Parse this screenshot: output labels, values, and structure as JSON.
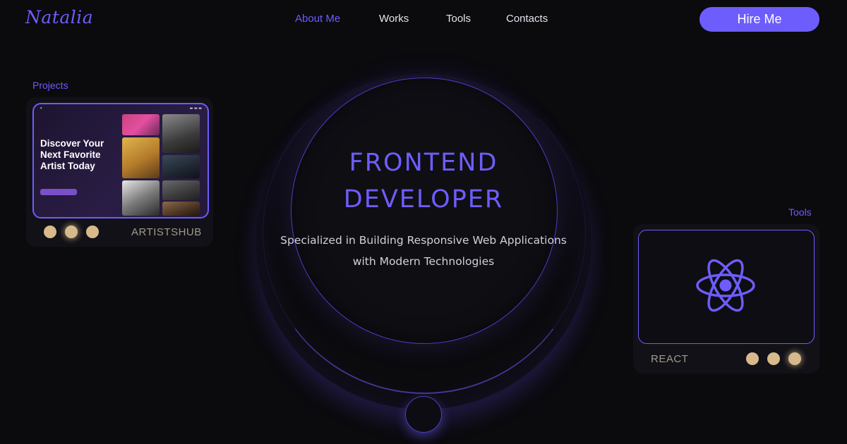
{
  "brand": {
    "logo": "Natalia"
  },
  "nav": {
    "items": [
      "About Me",
      "Works",
      "Tools",
      "Contacts"
    ],
    "active": "About Me"
  },
  "header": {
    "hire_label": "Hire Me"
  },
  "hero": {
    "title_line1": "FRONTEND",
    "title_line2": "DEVELOPER",
    "subtitle_line1": "Specialized in Building Responsive Web Applications",
    "subtitle_line2": "with Modern Technologies"
  },
  "projects": {
    "label": "Projects",
    "current_name": "ARTISTSHUB",
    "dot_count": 3,
    "active_dot": 2,
    "preview": {
      "heading": "Discover Your Next Favorite Artist Today"
    }
  },
  "tools": {
    "label": "Tools",
    "current_name": "REACT",
    "dot_count": 3,
    "active_dot": 3,
    "icon": "react-atom-icon"
  },
  "colors": {
    "accent": "#6d5dfc",
    "background": "#0b0a0d",
    "dot": "#d7b98b",
    "card": "#121117"
  }
}
